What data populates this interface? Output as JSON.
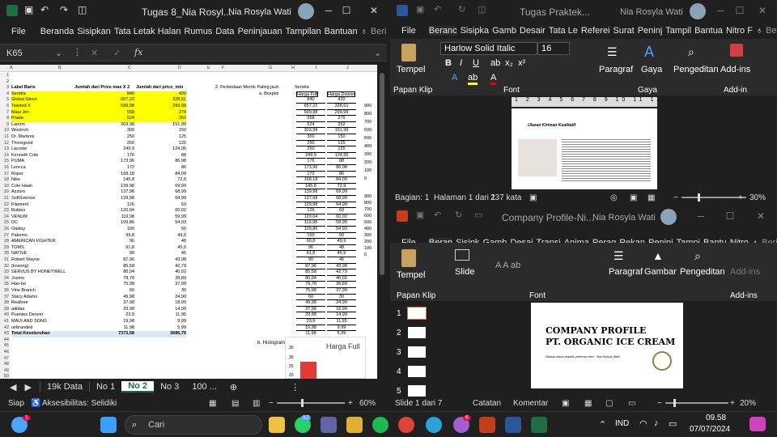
{
  "excel": {
    "title": "Tugas 8_Nia Rosyl...",
    "user": "Nia Rosyla Wati",
    "menu": [
      "File",
      "Beranda",
      "Sisipkan",
      "Tata Letak Halan",
      "Rumus",
      "Data",
      "Peninjauan",
      "Tampilan",
      "Bantuan",
      "Beri tahu"
    ],
    "namebox": "K65",
    "col_headers": [
      "A",
      "B",
      "C",
      "D",
      "E",
      "F",
      "G",
      "H",
      "I",
      "J"
    ],
    "headers": {
      "label": "Label Baris",
      "b": "Jumlah dari Price max X 2",
      "c": "Jumlah dari price_min",
      "f": "2. Perbedaan Merek Paling jauh",
      "f2": "a. Boxplot",
      "h": "Sendra",
      "h2": "Harga Full",
      "i2": "Harga Diskon"
    },
    "rows": [
      [
        "Sendra",
        "840",
        "420",
        "840",
        "420"
      ],
      [
        "Global Glove",
        "657,22",
        "328,61",
        "657,22",
        "328,61"
      ],
      [
        "Twisted X",
        "599,98",
        "299,99",
        "599,98",
        "299,99"
      ],
      [
        "Maui Jim",
        "558",
        "279",
        "558",
        "279"
      ],
      [
        "Prada",
        "524",
        "262",
        "524",
        "262"
      ],
      [
        "Lamrin",
        "303,98",
        "151,99",
        "303,98",
        "151,99"
      ],
      [
        "Woolrich",
        "300",
        "150",
        "300",
        "150"
      ],
      [
        "Dr. Martens",
        "250",
        "125",
        "250",
        "125"
      ],
      [
        "Thorogood",
        "250",
        "125",
        "250",
        "125"
      ],
      [
        "Lacoste",
        "249,9",
        "124,95",
        "249,9",
        "124,95"
      ],
      [
        "Kenneth Cole",
        "176",
        "88",
        "176",
        "88"
      ],
      [
        "PUMA",
        "173,96",
        "86,98",
        "173,96",
        "86,98"
      ],
      [
        "Lencca",
        "172",
        "86",
        "172",
        "86"
      ],
      [
        "Roper",
        "168,18",
        "84,09",
        "168,18",
        "84,09"
      ],
      [
        "Nike",
        "145,8",
        "72,9",
        "145,8",
        "72,9"
      ],
      [
        "Cole Haan",
        "139,98",
        "69,99",
        "139,98",
        "69,99"
      ],
      [
        "Azzuro",
        "137,98",
        "68,99",
        "137,98",
        "68,99"
      ],
      [
        "SoftScience",
        "129,98",
        "64,99",
        "129,98",
        "64,99"
      ],
      [
        "Filament",
        "126",
        "63",
        "126",
        "63"
      ],
      [
        "Rubies",
        "120,04",
        "60,02",
        "120,04",
        "60,02"
      ],
      [
        "VENUM",
        "119,98",
        "59,99",
        "119,98",
        "59,99"
      ],
      [
        "DC",
        "109,86",
        "54,93",
        "109,86",
        "54,93"
      ],
      [
        "Oakley",
        "100",
        "50",
        "100",
        "50"
      ],
      [
        "Pakems",
        "99,8",
        "49,9",
        "99,8",
        "49,9"
      ],
      [
        "AMERICAN FIGHTER",
        "96",
        "48",
        "96",
        "48"
      ],
      [
        "TOMS",
        "91,8",
        "45,9",
        "91,8",
        "45,9"
      ],
      [
        "NATIVE",
        "90",
        "45",
        "90",
        "45"
      ],
      [
        "Robert Wayne",
        "87,96",
        "43,98",
        "87,96",
        "43,98"
      ],
      [
        "(kosong)",
        "85,58",
        "42,79",
        "85,58",
        "42,79"
      ],
      [
        "SERVUS BY HONEYWELL",
        "80,04",
        "40,02",
        "80,04",
        "40,02"
      ],
      [
        "Josmo",
        "79,78",
        "39,89",
        "79,78",
        "39,89"
      ],
      [
        "Hao-bo",
        "75,98",
        "37,99",
        "75,98",
        "37,99"
      ],
      [
        "Vine Branch",
        "60",
        "30",
        "60",
        "30"
      ],
      [
        "Stacy Adams",
        "49,98",
        "24,99",
        "49,98",
        "24,99"
      ],
      [
        "Realtree",
        "37,98",
        "18,99",
        "37,98",
        "18,99"
      ],
      [
        "adidas",
        "29,98",
        "14,99",
        "29,98",
        "14,99"
      ],
      [
        "Puentes Denver",
        "23,9",
        "11,95",
        "23,9",
        "11,95"
      ],
      [
        "MAUI AND SONS",
        "19,98",
        "9,99",
        "19,98",
        "9,99"
      ],
      [
        "unbranded",
        "11,98",
        "5,99",
        "11,98",
        "5,99"
      ],
      [
        "Total Keseluruhan",
        "7373,58",
        "3686,79",
        "",
        ""
      ]
    ],
    "axis_labels": [
      "900",
      "800",
      "700",
      "600",
      "500",
      "400",
      "300",
      "200",
      "100",
      "0"
    ],
    "histogram_label": "b. Histogram",
    "histogram_title": "Harga Full",
    "hist_axis": [
      "35",
      "30",
      "25",
      "20"
    ],
    "sheets": [
      "19k Data",
      "No 1",
      "No 2",
      "No 3",
      "100 ..."
    ],
    "status_ready": "Siap",
    "accessibility": "Aksesibilitas: Selidiki",
    "zoom": "60%"
  },
  "word": {
    "title": "Tugas Praktek...",
    "user": "Nia Rosyla Wati",
    "menu": [
      "File",
      "Beranc",
      "Sisipka",
      "Gamb",
      "Desair",
      "Tata Le",
      "Referei",
      "Surat",
      "Peninj",
      "Tampil",
      "Bantua",
      "Nitro F",
      "Beri tahu"
    ],
    "font": "Harlow Solid Italic",
    "font_size": "16",
    "groups": [
      "Papan Klip",
      "Font",
      "Gaya",
      "Add-in"
    ],
    "buttons": [
      "Tempel",
      "Paragraf",
      "Gaya",
      "Pengeditan",
      "Add-ins"
    ],
    "doc_title": "Ulasan Kiriman Kualitatif",
    "status": [
      "Bagian: 1",
      "Halaman 1 dari 1",
      "237 kata"
    ],
    "zoom": "30%"
  },
  "ppt": {
    "title": "Company Profile-Ni...",
    "user": "Nia Rosyla Wati",
    "menu": [
      "File",
      "Beran",
      "Sisipk",
      "Gamb",
      "Desai",
      "Transi",
      "Anima",
      "Perag",
      "Rekan",
      "Peninj",
      "Tampi",
      "Bantu",
      "Nitro",
      "Beri tahu"
    ],
    "groups": [
      "Papan Klip",
      "Font",
      "Add-ins"
    ],
    "buttons": [
      "Tempel",
      "Slide",
      "Paragraf",
      "Gambar",
      "Pengeditan",
      "Add-ins"
    ],
    "slide_title1": "COMPANY PROFILE",
    "slide_title2": "PT. ORGANIC ICE CREAM",
    "slide_sub": "Dibuat untuk praktik pertemu oleh : Nia Rosyla Wati",
    "thumbs": [
      "1",
      "2",
      "3",
      "4",
      "5"
    ],
    "status": [
      "Slide 1 dari 7",
      "Catatan",
      "Komentar"
    ],
    "zoom": "20%"
  },
  "taskbar": {
    "search": "Cari",
    "lang": "IND",
    "time": "09.58",
    "date": "07/07/2024",
    "badge1": "1",
    "badge2": "12",
    "badge3": "6"
  }
}
